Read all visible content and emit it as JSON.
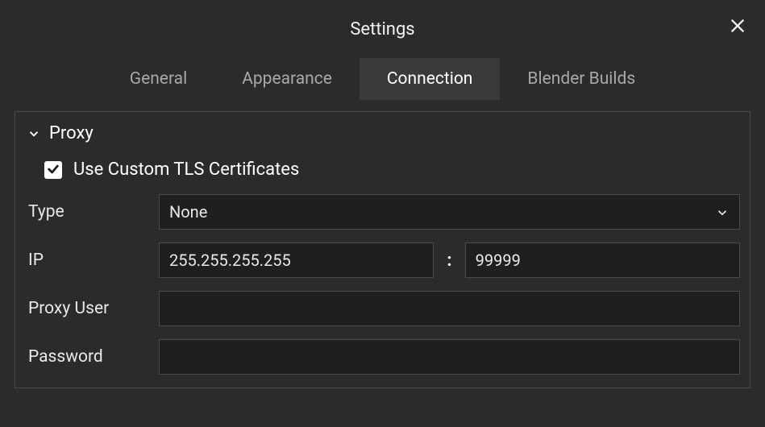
{
  "header": {
    "title": "Settings"
  },
  "tabs": [
    {
      "label": "General",
      "active": false
    },
    {
      "label": "Appearance",
      "active": false
    },
    {
      "label": "Connection",
      "active": true
    },
    {
      "label": "Blender Builds",
      "active": false
    }
  ],
  "proxy": {
    "section_title": "Proxy",
    "tls_label": "Use Custom TLS Certificates",
    "tls_checked": true,
    "type_label": "Type",
    "type_value": "None",
    "ip_label": "IP",
    "ip_value": "255.255.255.255",
    "port_separator": ":",
    "port_value": "99999",
    "user_label": "Proxy User",
    "user_value": "",
    "password_label": "Password",
    "password_value": ""
  }
}
